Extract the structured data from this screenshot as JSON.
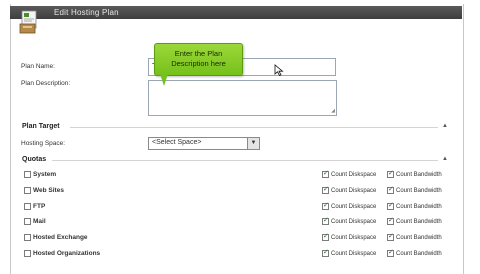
{
  "window": {
    "title": "Edit Hosting Plan"
  },
  "form": {
    "plan_name_label": "Plan Name:",
    "plan_name_value": "T",
    "plan_description_label": "Plan Description:"
  },
  "tooltip": {
    "text": "Enter the Plan Description here"
  },
  "plan_target": {
    "heading": "Plan Target",
    "hosting_space_label": "Hosting Space:",
    "hosting_space_selected": "<Select Space>"
  },
  "quotas": {
    "heading": "Quotas",
    "count_diskspace_label": "Count Diskspace",
    "count_bandwidth_label": "Count Bandwidth",
    "items": [
      {
        "name": "System",
        "enabled": false,
        "count_diskspace": true,
        "count_bandwidth": true
      },
      {
        "name": "Web Sites",
        "enabled": false,
        "count_diskspace": true,
        "count_bandwidth": true
      },
      {
        "name": "FTP",
        "enabled": false,
        "count_diskspace": true,
        "count_bandwidth": true
      },
      {
        "name": "Mail",
        "enabled": false,
        "count_diskspace": true,
        "count_bandwidth": true
      },
      {
        "name": "Hosted Exchange",
        "enabled": false,
        "count_diskspace": true,
        "count_bandwidth": true
      },
      {
        "name": "Hosted Organizations",
        "enabled": false,
        "count_diskspace": true,
        "count_bandwidth": true
      }
    ]
  },
  "colors": {
    "tooltip_bg": "#84cc16",
    "titlebar_bg": "#444444"
  }
}
